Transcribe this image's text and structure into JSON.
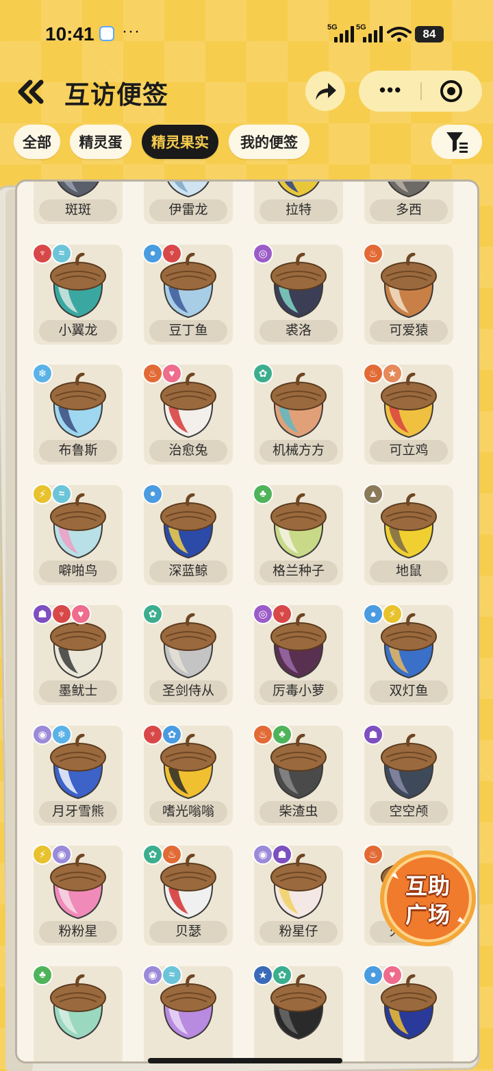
{
  "status_bar": {
    "time": "10:41",
    "more": "···",
    "net1": "5G",
    "net2": "5G",
    "battery": "84"
  },
  "header": {
    "title": "互访便签"
  },
  "tabs": [
    {
      "label": "全部",
      "active": false
    },
    {
      "label": "精灵蛋",
      "active": false
    },
    {
      "label": "精灵果实",
      "active": true
    },
    {
      "label": "我的便签",
      "active": false
    }
  ],
  "colors": {
    "accent": "#f7cd4e",
    "dark": "#1a1a1a",
    "paper": "#f8f4ea"
  },
  "cards": [
    {
      "name": "斑斑",
      "badges": [],
      "colors": [
        "#5b5f6b",
        "#9aa0ad"
      ]
    },
    {
      "name": "伊雷龙",
      "badges": [],
      "colors": [
        "#cfe3f0",
        "#7fa7c6"
      ]
    },
    {
      "name": "拉特",
      "badges": [],
      "colors": [
        "#e8c83a",
        "#2b3e8c"
      ]
    },
    {
      "name": "多西",
      "badges": [],
      "colors": [
        "#6e6a66",
        "#b9b1a8"
      ]
    },
    {
      "name": "小翼龙",
      "badges": [
        {
          "t": "fire-horn",
          "c": "#d94848"
        },
        {
          "t": "wing",
          "c": "#6cc4d8"
        }
      ],
      "colors": [
        "#3aa8a0",
        "#d4e8e0"
      ]
    },
    {
      "name": "豆丁鱼",
      "badges": [
        {
          "t": "water",
          "c": "#4a9be0"
        },
        {
          "t": "fire-horn",
          "c": "#d94848"
        }
      ],
      "colors": [
        "#a8cde6",
        "#3d5a9a"
      ]
    },
    {
      "name": "裘洛",
      "badges": [
        {
          "t": "poison",
          "c": "#9b5cc7"
        }
      ],
      "colors": [
        "#3c3e56",
        "#7fd6c6"
      ]
    },
    {
      "name": "可爱猿",
      "badges": [
        {
          "t": "fire",
          "c": "#e26a34"
        }
      ],
      "colors": [
        "#c98046",
        "#f1e0c8"
      ]
    },
    {
      "name": "布鲁斯",
      "badges": [
        {
          "t": "ice",
          "c": "#5ab2e6"
        }
      ],
      "colors": [
        "#9fd6f0",
        "#3a4e7e"
      ]
    },
    {
      "name": "治愈兔",
      "badges": [
        {
          "t": "fire",
          "c": "#e26a34"
        },
        {
          "t": "heart",
          "c": "#ee6c8c"
        }
      ],
      "colors": [
        "#f3f0ec",
        "#d63a3a"
      ]
    },
    {
      "name": "机械方方",
      "badges": [
        {
          "t": "gear",
          "c": "#3cae8e"
        }
      ],
      "colors": [
        "#e2a078",
        "#5fb8c4"
      ]
    },
    {
      "name": "可立鸡",
      "badges": [
        {
          "t": "fire",
          "c": "#e26a34"
        },
        {
          "t": "star",
          "c": "#e58a5a"
        }
      ],
      "colors": [
        "#f0c040",
        "#d84242"
      ]
    },
    {
      "name": "噼啪鸟",
      "badges": [
        {
          "t": "electric",
          "c": "#e8c22c"
        },
        {
          "t": "wing",
          "c": "#6cc4d8"
        }
      ],
      "colors": [
        "#b8e0e6",
        "#ef9ec4"
      ]
    },
    {
      "name": "深蓝鲸",
      "badges": [
        {
          "t": "water",
          "c": "#4a9be0"
        }
      ],
      "colors": [
        "#2c4aa8",
        "#f2d048"
      ]
    },
    {
      "name": "格兰种子",
      "badges": [
        {
          "t": "grass",
          "c": "#4fb35a"
        }
      ],
      "colors": [
        "#c8da88",
        "#f4f2e4"
      ]
    },
    {
      "name": "地鼠",
      "badges": [
        {
          "t": "ground",
          "c": "#8a7a5a"
        }
      ],
      "colors": [
        "#f0d030",
        "#7a6a4a"
      ]
    },
    {
      "name": "墨鱿士",
      "badges": [
        {
          "t": "ghost",
          "c": "#7d4fbf"
        },
        {
          "t": "fire-horn",
          "c": "#d94848"
        },
        {
          "t": "heart",
          "c": "#ee6c8c"
        }
      ],
      "colors": [
        "#eae6d8",
        "#3a3a3a"
      ]
    },
    {
      "name": "圣剑侍从",
      "badges": [
        {
          "t": "gear",
          "c": "#3cae8e"
        }
      ],
      "colors": [
        "#c4c4c4",
        "#e6e2d8"
      ]
    },
    {
      "name": "厉毒小萝",
      "badges": [
        {
          "t": "poison",
          "c": "#9b5cc7"
        },
        {
          "t": "fire-horn",
          "c": "#d94848"
        }
      ],
      "colors": [
        "#5a3050",
        "#9a6aa8"
      ]
    },
    {
      "name": "双灯鱼",
      "badges": [
        {
          "t": "water",
          "c": "#4a9be0"
        },
        {
          "t": "electric",
          "c": "#e8c22c"
        }
      ],
      "colors": [
        "#3a70c8",
        "#e8b860"
      ]
    },
    {
      "name": "月牙雪熊",
      "badges": [
        {
          "t": "wind",
          "c": "#9a8ad8"
        },
        {
          "t": "ice",
          "c": "#5ab2e6"
        }
      ],
      "colors": [
        "#3d62c8",
        "#f0f4fa"
      ]
    },
    {
      "name": "嗜光嗡嗡",
      "badges": [
        {
          "t": "fire-horn",
          "c": "#d94848"
        },
        {
          "t": "gear",
          "c": "#4a9be0"
        }
      ],
      "colors": [
        "#f0c030",
        "#2a2a2a"
      ]
    },
    {
      "name": "柴渣虫",
      "badges": [
        {
          "t": "fire",
          "c": "#e26a34"
        },
        {
          "t": "grass",
          "c": "#4fb35a"
        }
      ],
      "colors": [
        "#4a4a4a",
        "#8a8a8a"
      ]
    },
    {
      "name": "空空颅",
      "badges": [
        {
          "t": "ghost",
          "c": "#7d4fbf"
        }
      ],
      "colors": [
        "#3e4a5a",
        "#8a8aa8"
      ]
    },
    {
      "name": "粉粉星",
      "badges": [
        {
          "t": "electric",
          "c": "#e8c22c"
        },
        {
          "t": "wind",
          "c": "#9a8ad8"
        }
      ],
      "colors": [
        "#f08ab8",
        "#f4d8e4"
      ]
    },
    {
      "name": "贝瑟",
      "badges": [
        {
          "t": "gear",
          "c": "#3cae8e"
        },
        {
          "t": "fire",
          "c": "#e26a34"
        }
      ],
      "colors": [
        "#f0f0f0",
        "#d63030"
      ]
    },
    {
      "name": "粉星仔",
      "badges": [
        {
          "t": "wind",
          "c": "#9a8ad8"
        },
        {
          "t": "ghost",
          "c": "#7d4fbf"
        }
      ],
      "colors": [
        "#f4e8e4",
        "#f2d060"
      ]
    },
    {
      "name": "火红尾",
      "badges": [
        {
          "t": "fire",
          "c": "#e26a34"
        }
      ],
      "colors": [
        "#3a3a52",
        "#e26a34"
      ]
    },
    {
      "name": "",
      "badges": [
        {
          "t": "grass",
          "c": "#4fb35a"
        }
      ],
      "colors": [
        "#9ad8c0",
        "#d8efe4"
      ]
    },
    {
      "name": "",
      "badges": [
        {
          "t": "wind",
          "c": "#9a8ad8"
        },
        {
          "t": "wing",
          "c": "#6cc4d8"
        }
      ],
      "colors": [
        "#b88ae0",
        "#e8d8f4"
      ]
    },
    {
      "name": "",
      "badges": [
        {
          "t": "star",
          "c": "#3a6ab8"
        },
        {
          "t": "gear",
          "c": "#3cae8e"
        }
      ],
      "colors": [
        "#2a2a2a",
        "#6a6a6a"
      ]
    },
    {
      "name": "",
      "badges": [
        {
          "t": "water",
          "c": "#4a9be0"
        },
        {
          "t": "heart",
          "c": "#ee6c8c"
        }
      ],
      "colors": [
        "#2a3a9a",
        "#f0c030"
      ]
    }
  ],
  "floating": {
    "line1": "互助",
    "line2": "广场"
  }
}
